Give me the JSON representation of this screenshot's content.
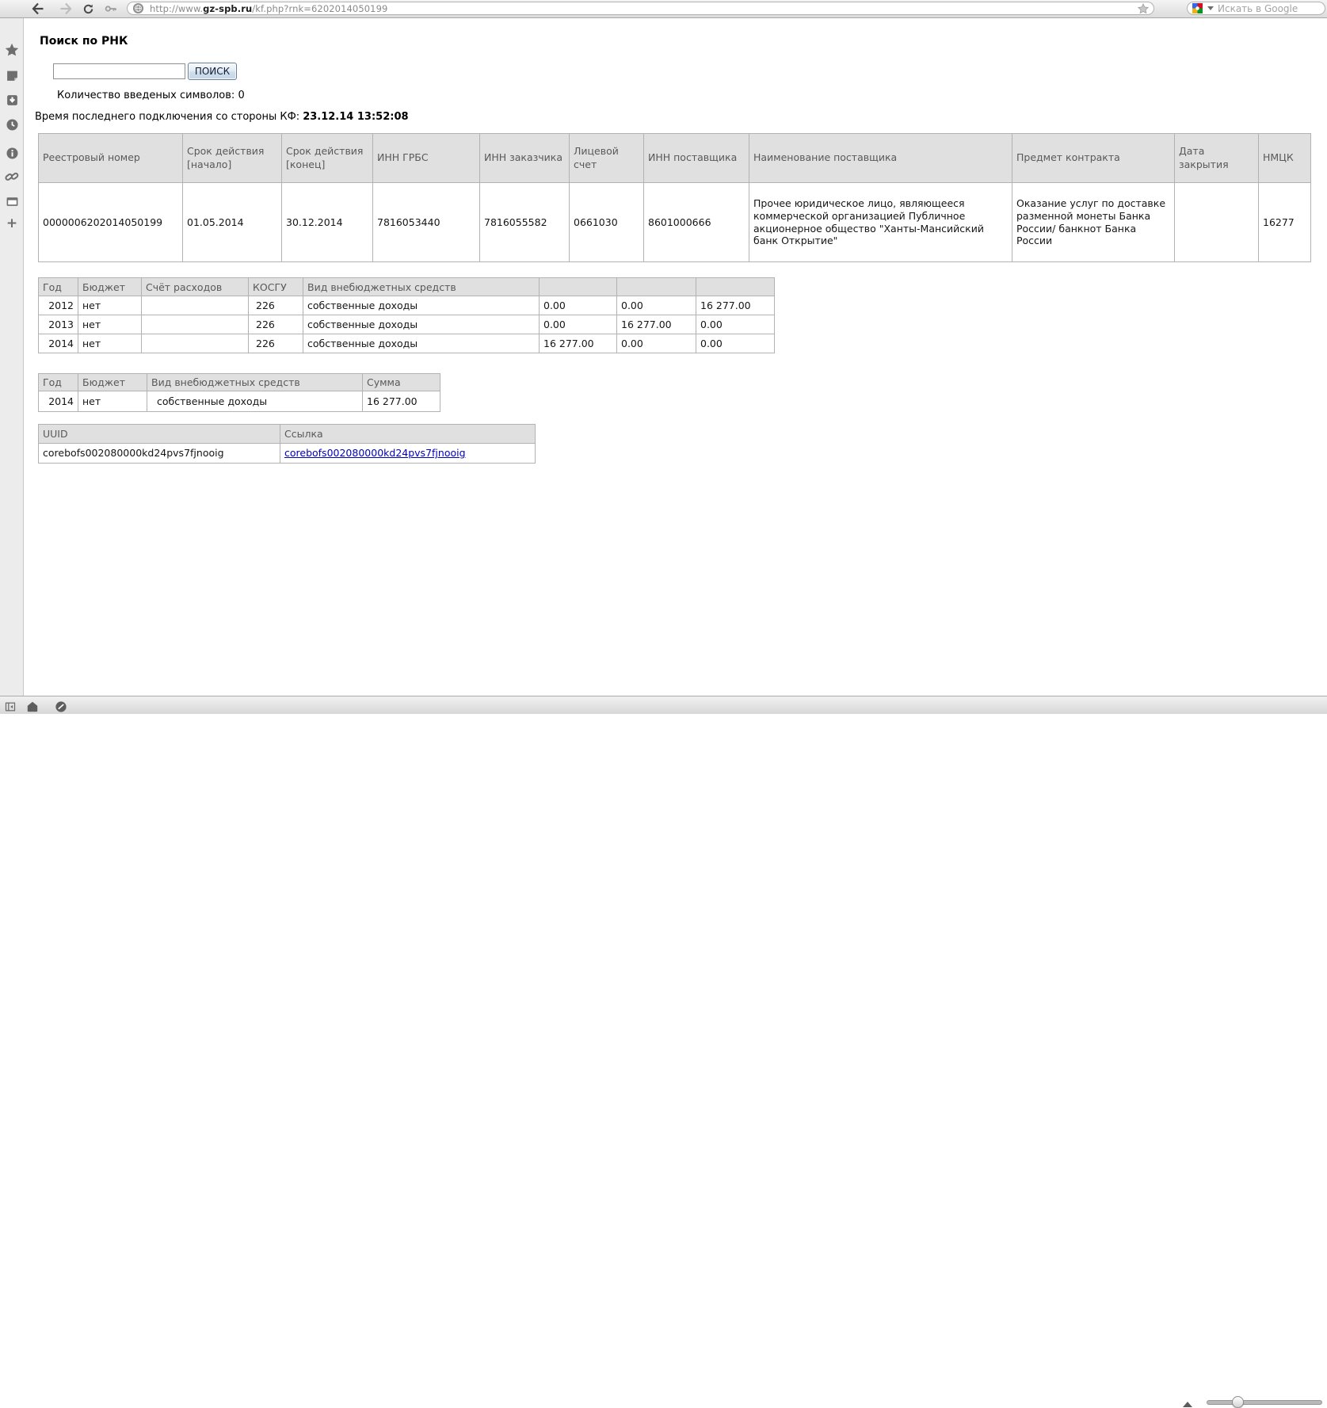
{
  "browser": {
    "toolbar": {
      "url_prefix": "http://www.",
      "url_domain": "gz-spb.ru",
      "url_path": "/kf.php?rnk=6202014050199",
      "search_placeholder": "Искать в Google"
    },
    "icons": {
      "back": "left-arrow",
      "forward": "right-arrow",
      "reload": "circular-arrow",
      "key": "key",
      "site_badge": "globe",
      "bookmark_star": "star",
      "search_engine": "google-logo",
      "search_caret": "down-caret",
      "sidebar": [
        "bookmarks-star",
        "notes",
        "downloads",
        "history-clock",
        "info",
        "links-chain",
        "windows",
        "add-panel-plus"
      ],
      "sidebar_plus_glyph": "+",
      "statusbar": [
        "panels-toggle",
        "home-shield",
        "status-circle",
        "zoom-fit-triangle",
        "zoom-slider"
      ]
    }
  },
  "page": {
    "heading": "Поиск по РНК",
    "search_form": {
      "input_value": "",
      "button_label": "ПОИСК",
      "counter_text": "Количество введеных символов: 0"
    },
    "connection": {
      "label": "Время последнего подключения со стороны КФ:",
      "value": "23.12.14 13:52:08"
    },
    "contract_table": {
      "headers": [
        "Реестровый номер",
        "Срок действия [начало]",
        "Срок действия [конец]",
        "ИНН ГРБС",
        "ИНН заказчика",
        "Лицевой счет",
        "ИНН поставщика",
        "Наименование поставщика",
        "Предмет контракта",
        "Дата закрытия",
        "НМЦК"
      ],
      "rows": [
        [
          "0000006202014050199",
          "01.05.2014",
          "30.12.2014",
          "7816053440",
          "7816055582",
          "0661030",
          "8601000666",
          "Прочее юридическое лицо, являющееся коммерческой организацией Публичное акционерное общество \"Ханты-Мансийский банк Открытие\"",
          "Оказание услуг по доставке разменной монеты Банка России/ банкнот Банка России",
          "",
          "16277"
        ]
      ]
    },
    "budget_table": {
      "headers": [
        "Год",
        "Бюджет",
        "Счёт расходов",
        "КОСГУ",
        "Вид внебюджетных средств",
        "",
        "",
        ""
      ],
      "rows": [
        [
          "2012",
          "нет",
          "",
          "226",
          "собственные доходы",
          "0.00",
          "0.00",
          "16 277.00"
        ],
        [
          "2013",
          "нет",
          "",
          "226",
          "собственные доходы",
          "0.00",
          "16 277.00",
          "0.00"
        ],
        [
          "2014",
          "нет",
          "",
          "226",
          "собственные доходы",
          "16 277.00",
          "0.00",
          "0.00"
        ]
      ]
    },
    "sum_table": {
      "headers": [
        "Год",
        "Бюджет",
        "Вид внебюджетных средств",
        "Сумма"
      ],
      "rows": [
        [
          "2014",
          "нет",
          "собственные доходы",
          "16 277.00"
        ]
      ]
    },
    "uuid_table": {
      "headers": [
        "UUID",
        "Ссылка"
      ],
      "link_columns": [
        1
      ],
      "rows": [
        [
          "corebofs002080000kd24pvs7fjnooig",
          "corebofs002080000kd24pvs7fjnooig"
        ]
      ]
    }
  }
}
